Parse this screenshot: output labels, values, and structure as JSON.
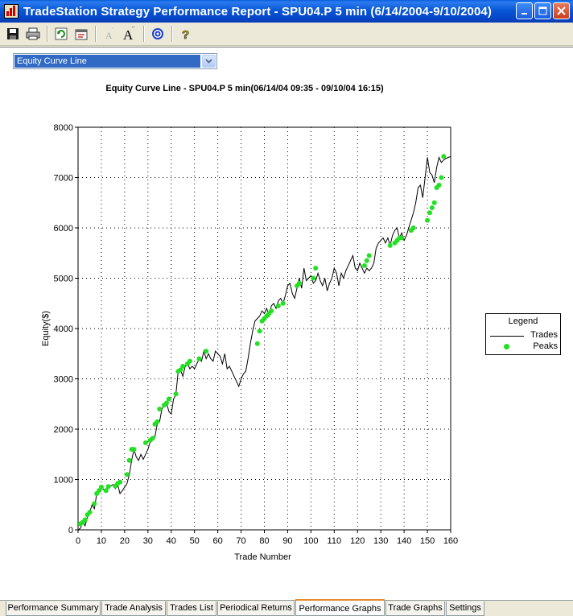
{
  "window": {
    "title": "TradeStation Strategy Performance Report - SPU04.P 5 min (6/14/2004-9/10/2004)",
    "buttons": [
      "minimize",
      "maximize",
      "close"
    ]
  },
  "toolbar": {
    "icons": [
      "save-icon",
      "print-icon",
      "refresh-icon",
      "properties-icon",
      "decrease-font-icon",
      "increase-font-icon",
      "target-icon",
      "help-icon"
    ]
  },
  "graph_select": {
    "selected": "Equity Curve Line"
  },
  "tabs": [
    "Performance Summary",
    "Trade Analysis",
    "Trades List",
    "Periodical Returns",
    "Performance Graphs",
    "Trade Graphs",
    "Settings"
  ],
  "active_tab": "Performance Graphs",
  "legend": {
    "title": "Legend",
    "items": [
      "Trades",
      "Peaks"
    ]
  },
  "colors": {
    "line": "#000000",
    "peaks": "#22e022",
    "accent": "#316ac5"
  },
  "chart_data": {
    "type": "line",
    "title": "Equity Curve Line - SPU04.P 5 min(06/14/04 09:35 - 09/10/04 16:15)",
    "xlabel": "Trade Number",
    "ylabel": "Equity($)",
    "xlim": [
      0,
      160
    ],
    "ylim": [
      0,
      8000
    ],
    "xticks": [
      "0",
      "10",
      "20",
      "30",
      "40",
      "50",
      "60",
      "70",
      "80",
      "90",
      "100",
      "110",
      "120",
      "130",
      "140",
      "150",
      "160"
    ],
    "yticks": [
      "0",
      "1000",
      "2000",
      "3000",
      "4000",
      "5000",
      "6000",
      "7000",
      "8000"
    ],
    "grid": true,
    "legend_position": "right",
    "series": [
      {
        "name": "Trades",
        "x": [
          0,
          1,
          2,
          3,
          4,
          5,
          6,
          7,
          8,
          9,
          10,
          11,
          12,
          13,
          14,
          15,
          16,
          17,
          18,
          19,
          20,
          21,
          22,
          23,
          24,
          25,
          26,
          27,
          28,
          29,
          30,
          31,
          32,
          33,
          34,
          35,
          36,
          37,
          38,
          39,
          40,
          41,
          42,
          43,
          44,
          45,
          46,
          47,
          48,
          49,
          50,
          51,
          52,
          53,
          54,
          55,
          56,
          57,
          58,
          59,
          60,
          61,
          62,
          63,
          64,
          65,
          66,
          67,
          68,
          69,
          70,
          71,
          72,
          73,
          74,
          75,
          76,
          77,
          78,
          79,
          80,
          81,
          82,
          83,
          84,
          85,
          86,
          87,
          88,
          89,
          90,
          91,
          92,
          93,
          94,
          95,
          96,
          97,
          98,
          99,
          100,
          101,
          102,
          103,
          104,
          105,
          106,
          107,
          108,
          109,
          110,
          111,
          112,
          113,
          114,
          115,
          116,
          117,
          118,
          119,
          120,
          121,
          122,
          123,
          124,
          125,
          126,
          127,
          128,
          129,
          130,
          131,
          132,
          133,
          134,
          135,
          136,
          137,
          138,
          139,
          140,
          141,
          142,
          143,
          144,
          145,
          146,
          147,
          148,
          149,
          150,
          151,
          152,
          153,
          154,
          155,
          156,
          157,
          158,
          159,
          160
        ],
        "values": [
          0,
          30,
          150,
          80,
          250,
          350,
          500,
          420,
          720,
          780,
          850,
          800,
          780,
          850,
          870,
          900,
          820,
          900,
          720,
          780,
          850,
          920,
          1100,
          1380,
          1600,
          1450,
          1380,
          1500,
          1400,
          1500,
          1600,
          1750,
          1780,
          1850,
          2100,
          2150,
          2400,
          2480,
          2520,
          2350,
          2300,
          2600,
          2680,
          3150,
          3180,
          3050,
          3250,
          3300,
          3200,
          3250,
          3200,
          3300,
          3400,
          3350,
          3550,
          3400,
          3500,
          3400,
          3350,
          3550,
          3500,
          3450,
          3300,
          3500,
          3200,
          3250,
          3150,
          3050,
          2950,
          2850,
          3000,
          3100,
          3150,
          3400,
          3700,
          3950,
          4150,
          4200,
          4250,
          4350,
          4300,
          4400,
          4250,
          4450,
          4500,
          4400,
          4550,
          4600,
          4500,
          4650,
          4850,
          4900,
          4700,
          4600,
          4800,
          5000,
          4800,
          5200,
          4950,
          5000,
          5050,
          4900,
          4950,
          5100,
          4950,
          4850,
          5000,
          4750,
          4900,
          5000,
          5200,
          5100,
          4850,
          5100,
          5000,
          5150,
          5250,
          5350,
          5450,
          5200,
          5150,
          5300,
          5200,
          5100,
          5200,
          5150,
          5200,
          5300,
          5600,
          5700,
          5750,
          5800,
          5700,
          5800,
          5650,
          5850,
          5950,
          6000,
          5800,
          5900,
          5750,
          5850,
          6000,
          6150,
          6300,
          6500,
          6800,
          6850,
          6600,
          7000,
          7400,
          7100,
          7050,
          6900,
          7200,
          7400,
          7300,
          7350,
          7380,
          7400,
          7420
        ],
        "color": "#000000"
      },
      {
        "name": "Peaks",
        "x": [
          1,
          2,
          3,
          4,
          5,
          7,
          8,
          9,
          10,
          12,
          13,
          16,
          17,
          18,
          21,
          22,
          23,
          24,
          29,
          31,
          32,
          33,
          34,
          35,
          37,
          38,
          39,
          42,
          43,
          44,
          45,
          47,
          48,
          52,
          55,
          77,
          78,
          79,
          80,
          81,
          82,
          83,
          86,
          88,
          94,
          95,
          101,
          102,
          123,
          124,
          125,
          134,
          136,
          137,
          138,
          139,
          143,
          144,
          150,
          151,
          152,
          153,
          154,
          155,
          156,
          157
        ],
        "values": [
          120,
          150,
          200,
          300,
          350,
          520,
          720,
          780,
          850,
          780,
          860,
          870,
          920,
          950,
          1100,
          1380,
          1600,
          1600,
          1730,
          1780,
          1820,
          2100,
          2150,
          2400,
          2480,
          2520,
          2600,
          2700,
          3150,
          3180,
          3250,
          3300,
          3350,
          3400,
          3550,
          3700,
          3950,
          4150,
          4200,
          4250,
          4300,
          4350,
          4450,
          4500,
          4850,
          4900,
          5000,
          5200,
          5250,
          5350,
          5450,
          5650,
          5700,
          5750,
          5800,
          5800,
          5950,
          6000,
          6150,
          6300,
          6400,
          6500,
          6800,
          6850,
          7000,
          7420
        ],
        "color": "#22e022"
      }
    ]
  }
}
